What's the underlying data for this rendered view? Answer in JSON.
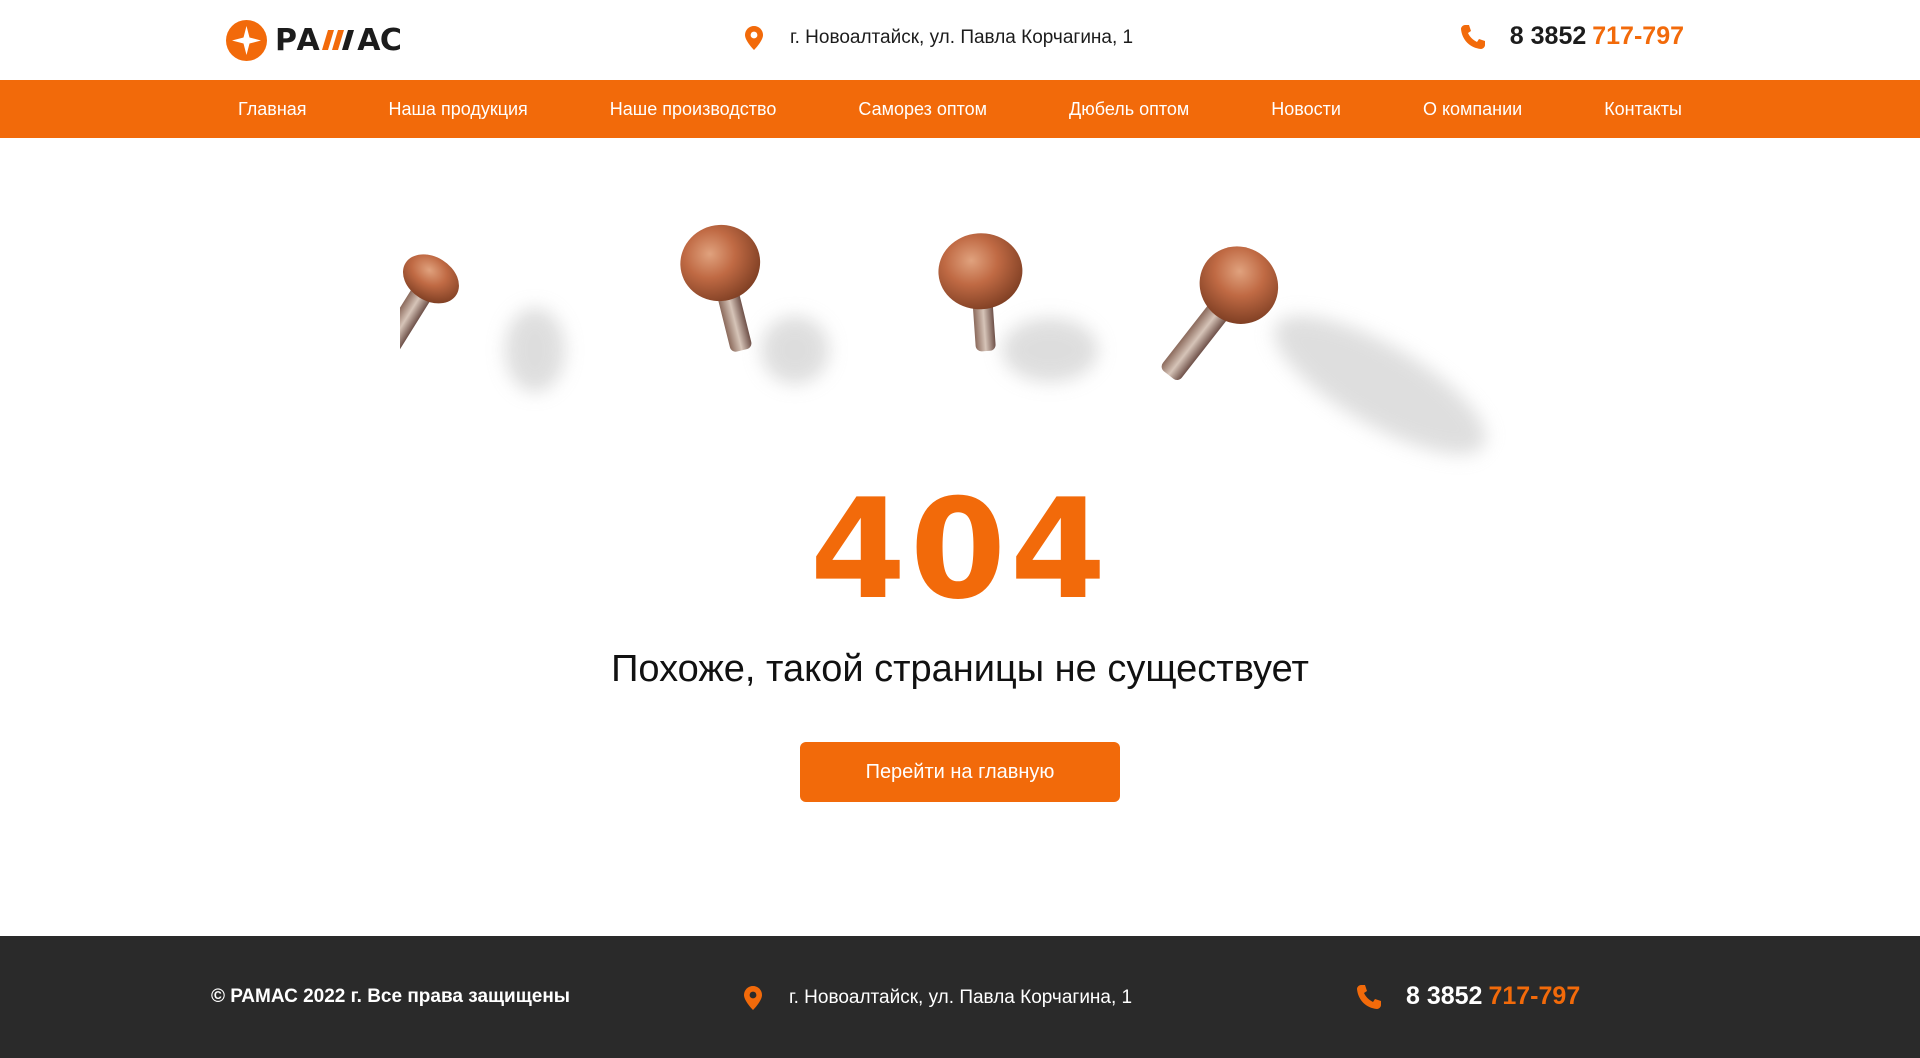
{
  "brand": {
    "name": "РАМАС",
    "name_left": "РА",
    "name_right": "АС",
    "accent": "#f26a0a",
    "dark": "#2a2a2a"
  },
  "header": {
    "address": "г. Новоалтайск, ул. Павла Корчагина, 1",
    "phone_prefix": "8 3852",
    "phone_main": "717-797",
    "icons": {
      "address": "map-pin-icon",
      "phone": "phone-icon"
    }
  },
  "nav": {
    "items": [
      {
        "label": "Главная"
      },
      {
        "label": "Наша продукция"
      },
      {
        "label": "Наше производство"
      },
      {
        "label": "Саморез оптом"
      },
      {
        "label": "Дюбель оптом"
      },
      {
        "label": "Новости"
      },
      {
        "label": "О компании"
      },
      {
        "label": "Контакты"
      }
    ]
  },
  "main": {
    "error_code": "404",
    "message": "Похоже, такой страницы не существует",
    "home_button": "Перейти на главную",
    "illustration": "rusty-nails-image"
  },
  "footer": {
    "copyright": "© РАМАС 2022 г. Все права защищены",
    "address": "г. Новоалтайск, ул. Павла Корчагина, 1",
    "phone_prefix": "8 3852",
    "phone_main": "717-797"
  }
}
